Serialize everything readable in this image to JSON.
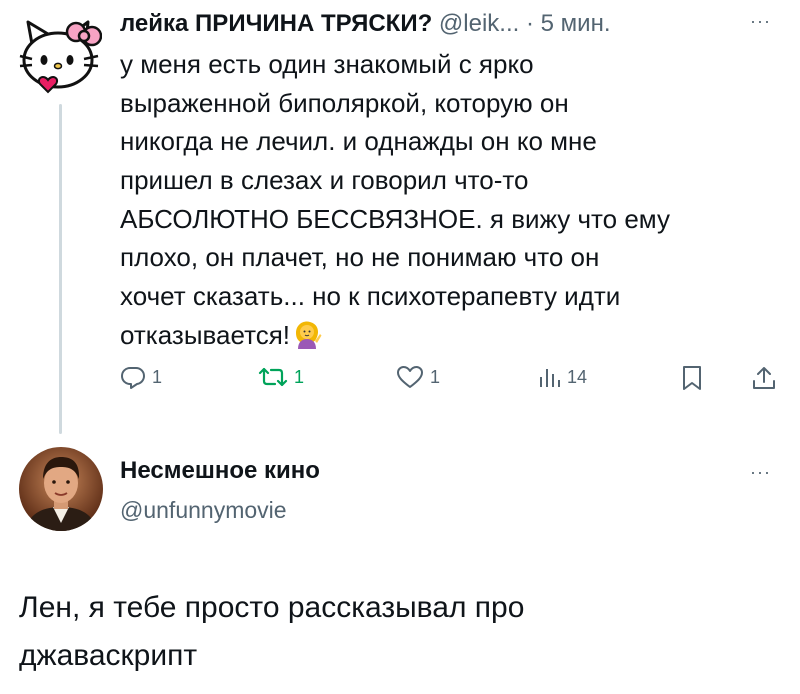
{
  "tweet1": {
    "author_name": "лейка ПРИЧИНА ТРЯСКИ?",
    "handle": "@leik...",
    "separator": "·",
    "time": "5 мин.",
    "more": "···",
    "text_lines": [
      "у меня есть один знакомый с ярко",
      "выраженной биполяркой, которую он",
      "никогда не лечил. и однажды он ко мне",
      "пришел в слезах и говорил что-то",
      "АБСОЛЮТНО БЕССВЯЗНОЕ. я вижу что ему",
      "плохо, он плачет, но не понимаю что он",
      "хочет сказать... но к психотерапевту идти",
      "отказывается!"
    ],
    "trailing_emoji": "person-tipping-hand-emoji",
    "actions": {
      "reply_count": "1",
      "retweet_count": "1",
      "like_count": "1",
      "views_count": "14"
    }
  },
  "tweet2": {
    "author_name": "Несмешное кино",
    "handle": "@unfunnymovie",
    "more": "···",
    "text_lines": [
      "Лен, я тебе просто рассказывал про",
      "джаваскрипт"
    ]
  },
  "colors": {
    "text": "#0f1419",
    "secondary": "#536471",
    "retweet_accent": "#00a35a",
    "thread_line": "#cfd9de"
  }
}
